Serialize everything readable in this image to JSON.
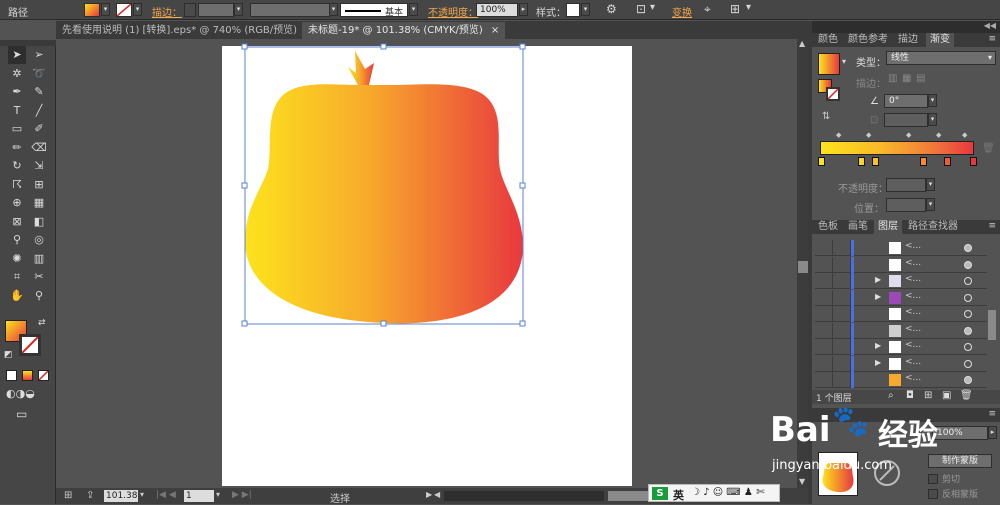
{
  "control_bar": {
    "mode": "路径",
    "stroke_label": "描边：",
    "stroke_style": "基本",
    "opacity_label": "不透明度：",
    "opacity_value": "100%",
    "style_label": "样式：",
    "transform_label": "变换"
  },
  "tabs": [
    {
      "label": "先看使用说明 (1) [转换].eps* @ 740% (RGB/预览)",
      "close": "×"
    },
    {
      "label": "未标题-19* @ 101.38% (CMYK/预览)",
      "close": "×"
    }
  ],
  "tools": [
    {
      "name": "selection-tool",
      "glyph": "➤"
    },
    {
      "name": "direct-selection-tool",
      "glyph": "➢"
    },
    {
      "name": "magic-wand-tool",
      "glyph": "✲"
    },
    {
      "name": "lasso-tool",
      "glyph": "➰"
    },
    {
      "name": "pen-tool",
      "glyph": "✒"
    },
    {
      "name": "curvature-tool",
      "glyph": "✎"
    },
    {
      "name": "type-tool",
      "glyph": "T"
    },
    {
      "name": "line-tool",
      "glyph": "╱"
    },
    {
      "name": "rectangle-tool",
      "glyph": "▭"
    },
    {
      "name": "paintbrush-tool",
      "glyph": "✐"
    },
    {
      "name": "pencil-tool",
      "glyph": "✏"
    },
    {
      "name": "eraser-tool",
      "glyph": "⌫"
    },
    {
      "name": "rotate-tool",
      "glyph": "↻"
    },
    {
      "name": "scale-tool",
      "glyph": "⇲"
    },
    {
      "name": "warp-tool",
      "glyph": "☈"
    },
    {
      "name": "free-transform-tool",
      "glyph": "⊞"
    },
    {
      "name": "shape-builder-tool",
      "glyph": "⊕"
    },
    {
      "name": "perspective-grid-tool",
      "glyph": "▦"
    },
    {
      "name": "mesh-tool",
      "glyph": "⊠"
    },
    {
      "name": "gradient-tool",
      "glyph": "◧"
    },
    {
      "name": "eyedropper-tool",
      "glyph": "⚲"
    },
    {
      "name": "blend-tool",
      "glyph": "◎"
    },
    {
      "name": "symbol-sprayer-tool",
      "glyph": "✺"
    },
    {
      "name": "column-graph-tool",
      "glyph": "▥"
    },
    {
      "name": "artboard-tool",
      "glyph": "⌗"
    },
    {
      "name": "slice-tool",
      "glyph": "✂"
    },
    {
      "name": "hand-tool",
      "glyph": "✋"
    },
    {
      "name": "zoom-tool",
      "glyph": "⚲"
    }
  ],
  "panel_tabs_top": [
    {
      "label": "颜色"
    },
    {
      "label": "颜色参考"
    },
    {
      "label": "描边"
    },
    {
      "label": "渐变"
    }
  ],
  "gradient": {
    "type_label": "类型：",
    "type_value": "线性",
    "stroke_label": "描边：",
    "angle_value": "0°",
    "opacity_label": "不透明度：",
    "position_label": "位置：",
    "colors": {
      "start": "#fde31c",
      "end": "#e8383f"
    }
  },
  "panel_tabs_mid": [
    {
      "label": "色板"
    },
    {
      "label": "画笔"
    },
    {
      "label": "图层"
    },
    {
      "label": "路径查找器"
    }
  ],
  "layers": [
    {
      "name": "<...",
      "expand": "",
      "target": "filled"
    },
    {
      "name": "<...",
      "expand": "",
      "target": "filled"
    },
    {
      "name": "<...",
      "expand": "▶",
      "target": "empty"
    },
    {
      "name": "<...",
      "expand": "▶",
      "target": "empty"
    },
    {
      "name": "<...",
      "expand": "",
      "target": "empty"
    },
    {
      "name": "<...",
      "expand": "",
      "target": "filled"
    },
    {
      "name": "<...",
      "expand": "▶",
      "target": "empty"
    },
    {
      "name": "<...",
      "expand": "▶",
      "target": "empty"
    },
    {
      "name": "<...",
      "expand": "",
      "target": "filled"
    }
  ],
  "layers_footer": {
    "count": "1 个图层"
  },
  "transparency": {
    "opacity": "100%",
    "make_mask": "制作蒙版",
    "clip": "剪切",
    "invert_mask": "反相蒙版"
  },
  "status": {
    "zoom": "101.38",
    "artboard": "1",
    "tool": "选择"
  },
  "ime": {
    "label": "英"
  },
  "watermark": {
    "brand": "Bai",
    "brand2": "经验",
    "url": "jingyan.baidu.com"
  }
}
